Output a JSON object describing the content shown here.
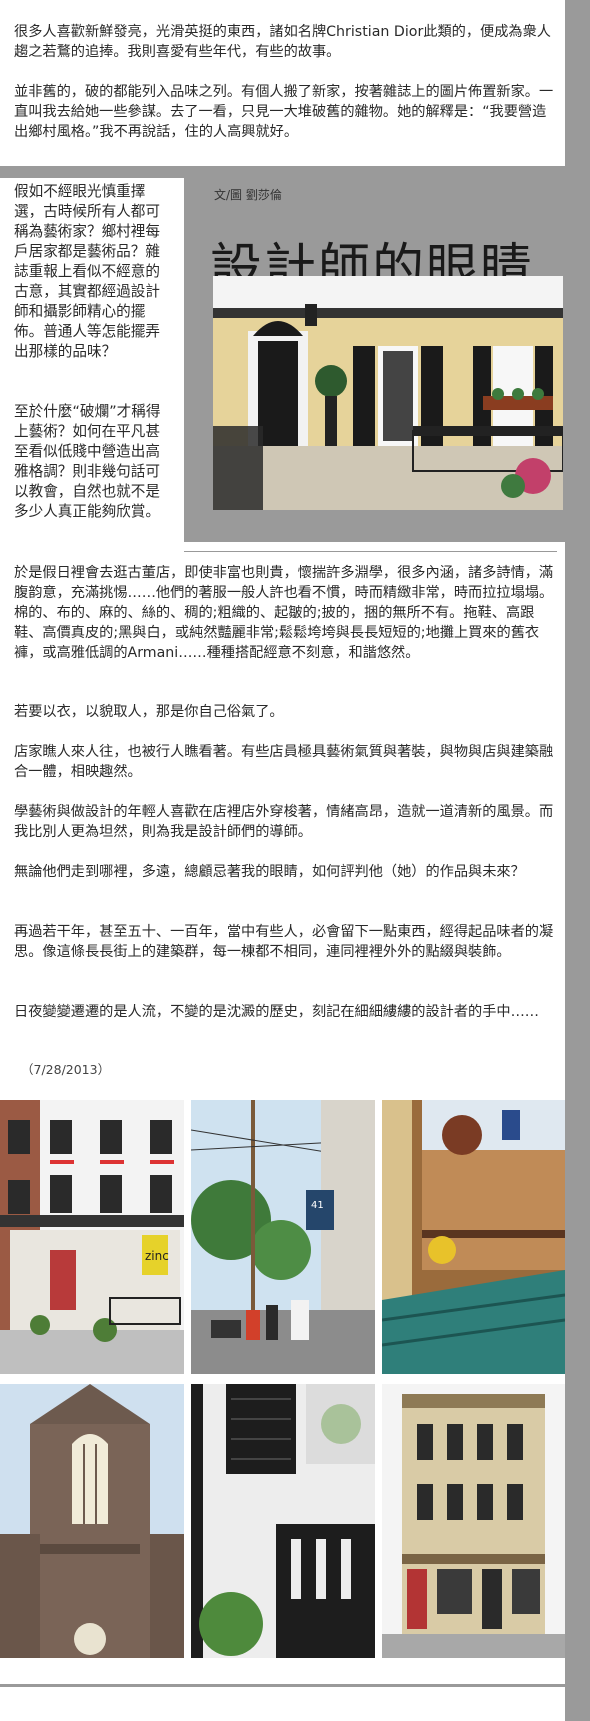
{
  "intro_paragraphs": [
    "很多人喜歡新鮮發亮，光滑英挺的東西，諸如名牌Christian Dior此類的，便成為衆人趨之若鶩的追捧。我則喜愛有些年代，有些的故事。",
    "並非舊的，破的都能列入品味之列。有個人搬了新家，按著雜誌上的圖片佈置新家。一直叫我去給她一些參謀。去了一看，只見一大堆破舊的雜物。她的解釋是：“我要營造出鄉村風格。”我不再說話，住的人高興就好。"
  ],
  "narrow_paragraphs": [
    "假如不經眼光慎重擇選，古時候所有人都可稱為藝術家？鄉村裡每戶居家都是藝術品？雜誌重報上看似不經意的古意，其實都經過設計師和攝影師精心的擺佈。普通人等怎能擺弄出那樣的品味？",
    "至於什麼“破爛”才稱得上藝術？如何在平凡甚至看似低賤中營造出高雅格調？則非幾句話可以教會，自然也就不是多少人真正能夠欣賞。"
  ],
  "article": {
    "byline": "文/圖 劉莎倫",
    "title": "設計師的眼睛"
  },
  "body_paragraphs": [
    "於是假日裡會去逛古董店，即使非富也則貴，懷揣許多淵學，很多內涵，諸多詩情，滿腹韵意，充滿挑惕……他們的著服一般人許也看不慣，時而精緻非常，時而拉拉塌塌。棉的、布的、麻的、絲的、稠的;粗織的、起皺的;披的，捆的無所不有。拖鞋、高跟鞋、高價真皮的;黑與白，或純然豔麗非常;鬆鬆垮垮與長長短短的;地攤上買來的舊衣褲，或高雅低調的Armani……種種搭配經意不刻意，和諧悠然。",
    "若要以衣，以貌取人，那是你自己俗氣了。",
    "店家瞧人來人往，也被行人瞧看著。有些店員極具藝術氣質與著裝，與物與店與建築融合一體，相映趣然。",
    "學藝術與做設計的年輕人喜歡在店裡店外穿梭著，情緒高昂，造就一道清新的風景。而我比別人更為坦然，則為我是設計師們的導師。",
    "無論他們走到哪裡，多遠，總顧忌著我的眼睛，如何評判他（她）的作品與未來？",
    "再過若干年，甚至五十、一百年，當中有些人，必會留下一點東西，經得起品味者的凝思。像這條長長街上的建築群，每一棟都不相同，連同裡裡外外的點綴與裝飾。",
    "日夜變變遷遷的是人流，不變的是沈澱的歷史，刻記在細細縷縷的設計者的手中……"
  ],
  "date": "（7/28/2013）",
  "photos": [
    {
      "name": "house-porch-photo"
    },
    {
      "name": "zinc-storefront-photo"
    },
    {
      "name": "street-scene-photo"
    },
    {
      "name": "cafe-window-photo"
    },
    {
      "name": "church-tower-photo"
    },
    {
      "name": "black-shutter-bench-photo"
    },
    {
      "name": "victorian-building-photo"
    }
  ],
  "sign_text": {
    "zinc": "zinc",
    "street_number": "41"
  },
  "colors": {
    "panel_gray": "#9a9a9a",
    "text": "#2a2a2a"
  }
}
